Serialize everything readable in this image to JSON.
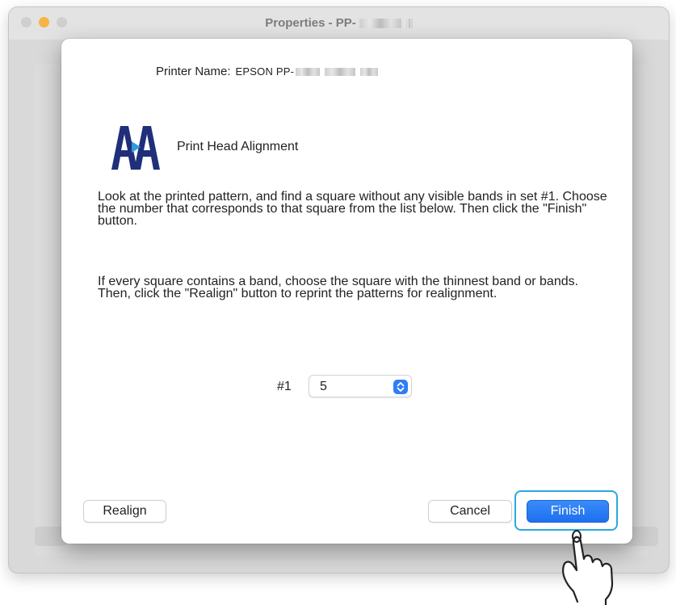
{
  "window": {
    "title": "Properties - PP-"
  },
  "sheet": {
    "printer_name_label": "Printer Name:",
    "printer_name_value": "EPSON PP-",
    "section_title": "Print Head Alignment",
    "instructions_1": "Look at the printed pattern, and find a square without any visible bands in set #1. Choose the number that corresponds to that square from the list below. Then click the \"Finish\" button.",
    "instructions_2": "If every square contains a band, choose the square with the thinnest band or bands. Then, click the \"Realign\" button to reprint the patterns for realignment.",
    "set_label": "#1",
    "set_selected_value": "5"
  },
  "buttons": {
    "realign": "Realign",
    "cancel": "Cancel",
    "finish": "Finish"
  },
  "colors": {
    "accent": "#1d6fef",
    "focus_ring": "#2aa8e0",
    "logo": "#1f2f7a"
  },
  "icons": {
    "logo": "print-head-alignment-icon",
    "stepper": "chevron-updown-icon",
    "pointer": "hand-pointer-icon"
  }
}
